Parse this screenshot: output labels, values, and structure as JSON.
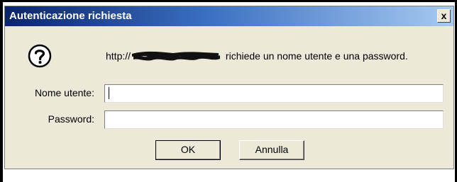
{
  "dialog": {
    "title": "Autenticazione richiesta",
    "close_label": "x",
    "message_prefix": "http://",
    "message_suffix": " richiede un nome utente e una password."
  },
  "form": {
    "username_label": "Nome utente:",
    "username_value": "",
    "password_label": "Password:",
    "password_value": ""
  },
  "buttons": {
    "ok_label": "OK",
    "cancel_label": "Annulla"
  },
  "icons": {
    "dialog_icon": "question-icon",
    "close_icon": "close-icon"
  },
  "colors": {
    "title_bar_start": "#0a246a",
    "title_bar_end": "#a6caf0",
    "dialog_bg": "#ece9d8"
  }
}
